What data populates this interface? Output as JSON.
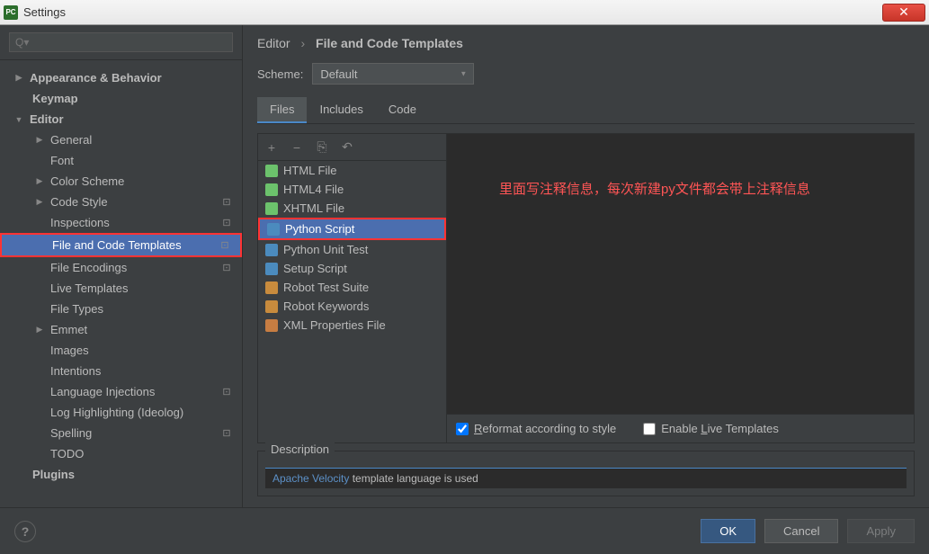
{
  "title_bar": {
    "title": "Settings",
    "icon_text": "PC"
  },
  "sidebar": {
    "search_placeholder": "Q▾",
    "items": [
      {
        "label": "Appearance & Behavior",
        "level": 0,
        "expandable": true,
        "expanded": false,
        "bold": true
      },
      {
        "label": "Keymap",
        "level": 0,
        "bold": true,
        "indent_extra": true
      },
      {
        "label": "Editor",
        "level": 0,
        "expandable": true,
        "expanded": true,
        "bold": true
      },
      {
        "label": "General",
        "level": 1,
        "expandable": true,
        "expanded": false
      },
      {
        "label": "Font",
        "level": 1
      },
      {
        "label": "Color Scheme",
        "level": 1,
        "expandable": true,
        "expanded": false
      },
      {
        "label": "Code Style",
        "level": 1,
        "expandable": true,
        "expanded": false,
        "badge": true
      },
      {
        "label": "Inspections",
        "level": 1,
        "badge": true
      },
      {
        "label": "File and Code Templates",
        "level": 1,
        "badge": true,
        "selected": true,
        "highlight": true
      },
      {
        "label": "File Encodings",
        "level": 1,
        "badge": true
      },
      {
        "label": "Live Templates",
        "level": 1
      },
      {
        "label": "File Types",
        "level": 1
      },
      {
        "label": "Emmet",
        "level": 1,
        "expandable": true,
        "expanded": false
      },
      {
        "label": "Images",
        "level": 1
      },
      {
        "label": "Intentions",
        "level": 1
      },
      {
        "label": "Language Injections",
        "level": 1,
        "badge": true
      },
      {
        "label": "Log Highlighting (Ideolog)",
        "level": 1
      },
      {
        "label": "Spelling",
        "level": 1,
        "badge": true
      },
      {
        "label": "TODO",
        "level": 1
      },
      {
        "label": "Plugins",
        "level": 0,
        "bold": true,
        "indent_extra": true
      }
    ]
  },
  "breadcrumb": {
    "root": "Editor",
    "current": "File and Code Templates"
  },
  "scheme": {
    "label": "Scheme:",
    "value": "Default"
  },
  "tabs": [
    {
      "label": "Files",
      "active": true
    },
    {
      "label": "Includes",
      "active": false
    },
    {
      "label": "Code",
      "active": false
    }
  ],
  "templates": [
    {
      "label": "HTML File",
      "icon": "html"
    },
    {
      "label": "HTML4 File",
      "icon": "html"
    },
    {
      "label": "XHTML File",
      "icon": "html"
    },
    {
      "label": "Python Script",
      "icon": "python",
      "selected": true,
      "highlight": true
    },
    {
      "label": "Python Unit Test",
      "icon": "python"
    },
    {
      "label": "Setup Script",
      "icon": "python"
    },
    {
      "label": "Robot Test Suite",
      "icon": "robot"
    },
    {
      "label": "Robot Keywords",
      "icon": "robot"
    },
    {
      "label": "XML Properties File",
      "icon": "xml"
    }
  ],
  "editor": {
    "annotation": "里面写注释信息，每次新建py文件都会带上注释信息",
    "reformat_label": "Reformat according to style",
    "reformat_checked": true,
    "live_templates_label": "Enable Live Templates",
    "live_templates_checked": false
  },
  "description": {
    "label": "Description",
    "link_text": "Apache Velocity",
    "text": " template language is used"
  },
  "footer": {
    "ok": "OK",
    "cancel": "Cancel",
    "apply": "Apply"
  }
}
